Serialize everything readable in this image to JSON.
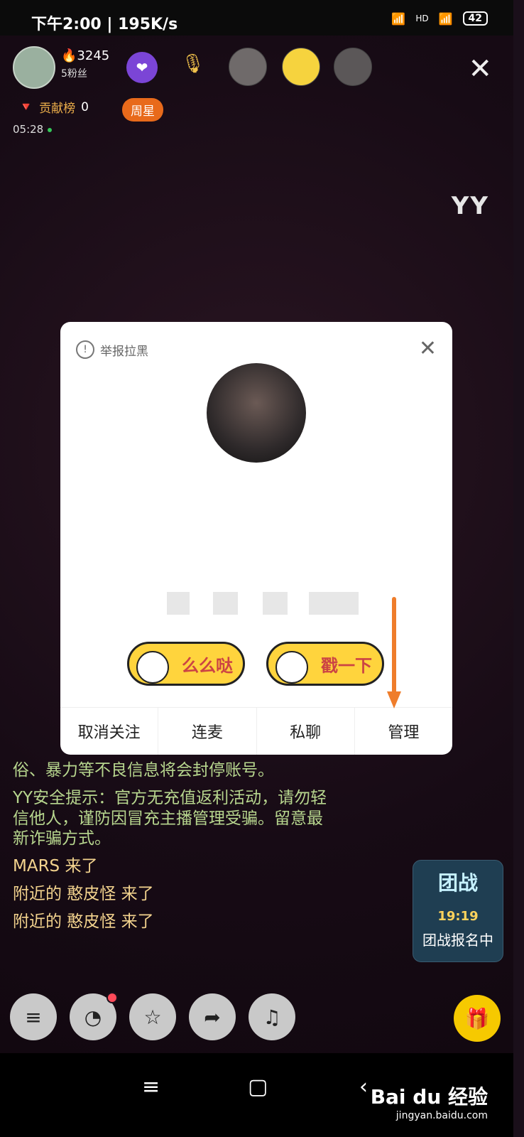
{
  "status_bar": {
    "time": "下午2:00 | 195K/s",
    "battery": "42",
    "signal_text": "HD"
  },
  "header": {
    "fire_count": "3245",
    "fans": "5粉丝",
    "contribution_label": "贡献榜",
    "contribution_count": "0",
    "weekly_star": "周星",
    "live_time": "05:28",
    "brand": "YY"
  },
  "modal": {
    "report_label": "举报拉黑",
    "buttons": [
      {
        "label": "么么哒"
      },
      {
        "label": "戳一下"
      }
    ],
    "actions": [
      {
        "label": "取消关注"
      },
      {
        "label": "连麦"
      },
      {
        "label": "私聊"
      },
      {
        "label": "管理"
      }
    ]
  },
  "chat": [
    {
      "text": "俗、暴力等不良信息将会封停账号。",
      "type": "safety"
    },
    {
      "text": "YY安全提示：官方无充值返利活动，请勿轻信他人，谨防因冒充主播管理受骗。留意最新诈骗方式。",
      "type": "safety"
    },
    {
      "text": "MARS 来了",
      "type": "enter"
    },
    {
      "text": "附近的 憨皮怪 来了",
      "type": "enter"
    },
    {
      "text": "附近的 憨皮怪 来了",
      "type": "enter"
    }
  ],
  "team_battle": {
    "title": "团战",
    "time": "19:19",
    "status": "团战报名中"
  },
  "watermark": {
    "brand": "Bai du 经验",
    "url": "jingyan.baidu.com"
  }
}
